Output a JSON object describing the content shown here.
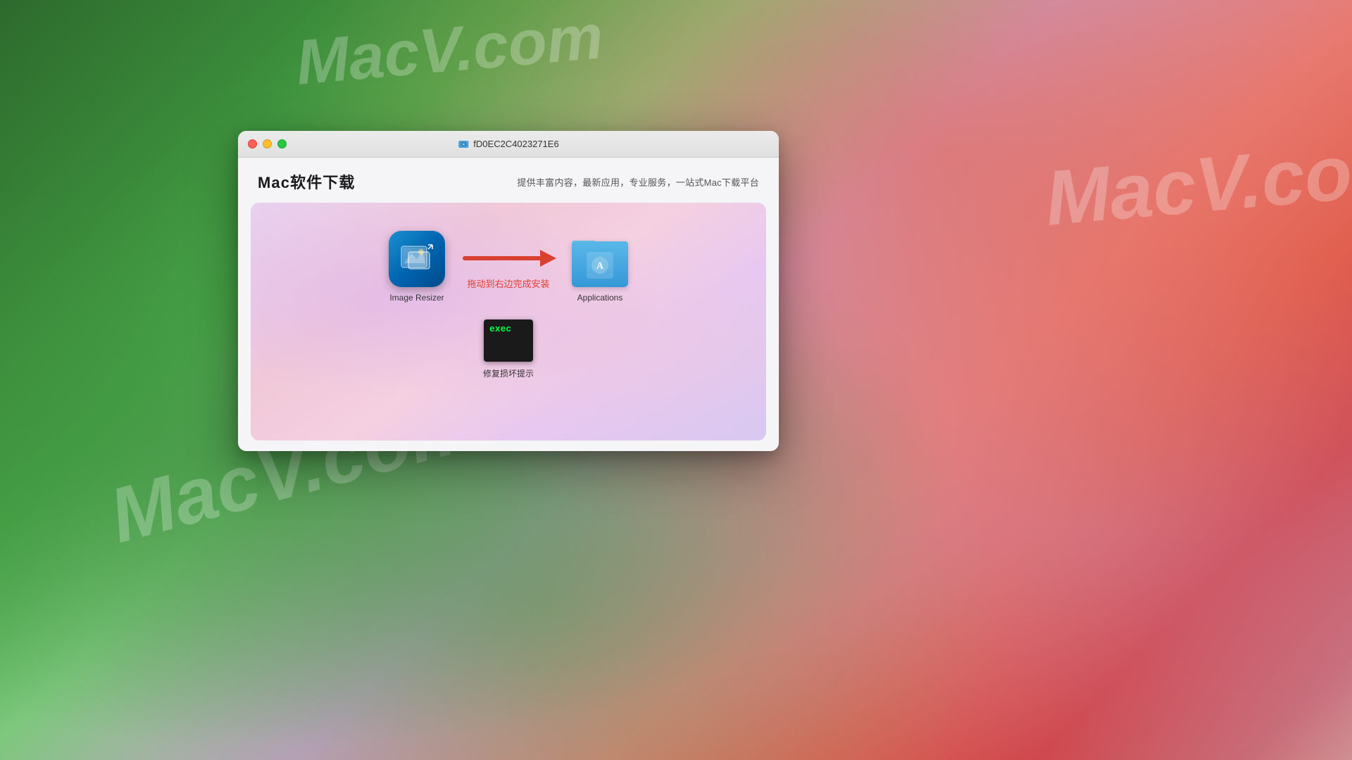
{
  "wallpaper": {
    "watermarks": [
      "MacV.com",
      "MacV.com",
      "MacV.co"
    ]
  },
  "window": {
    "titlebar": {
      "title": "fD0EC2C4023271E6",
      "traffic_lights": {
        "close": "close",
        "minimize": "minimize",
        "maximize": "maximize"
      }
    },
    "header": {
      "site_title": "Mac软件下载",
      "site_subtitle": "提供丰富内容，最新应用，专业服务，一站式Mac下载平台"
    },
    "dmg": {
      "app_name": "Image Resizer",
      "target_name": "Applications",
      "drag_hint": "拖动到右边完成安装",
      "exec_label": "修复损坏提示",
      "exec_text": "exec"
    }
  }
}
